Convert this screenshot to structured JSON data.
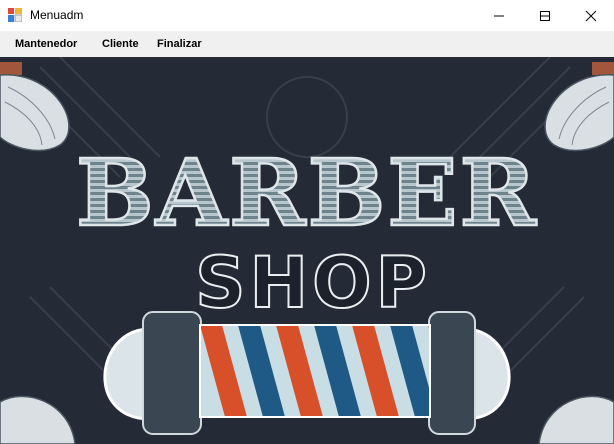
{
  "window": {
    "title": "Menuadm",
    "controls": [
      "minimize",
      "maximize",
      "close"
    ],
    "app_icon": "windows-form-icon"
  },
  "menu": {
    "items": [
      {
        "label": "Mantenedor"
      },
      {
        "label": "Cliente"
      },
      {
        "label": "Finalizar"
      }
    ]
  },
  "banner": {
    "line1": "BARBER",
    "line2": "SHOP",
    "icons": [
      "shaving-brush-icon",
      "barber-pole-icon"
    ],
    "colors": {
      "background": "#242b36",
      "letter_fill": "#8fa3ad",
      "pole_red": "#d8502a",
      "pole_blue": "#1f5a86",
      "pole_light": "#c9dde4"
    }
  }
}
